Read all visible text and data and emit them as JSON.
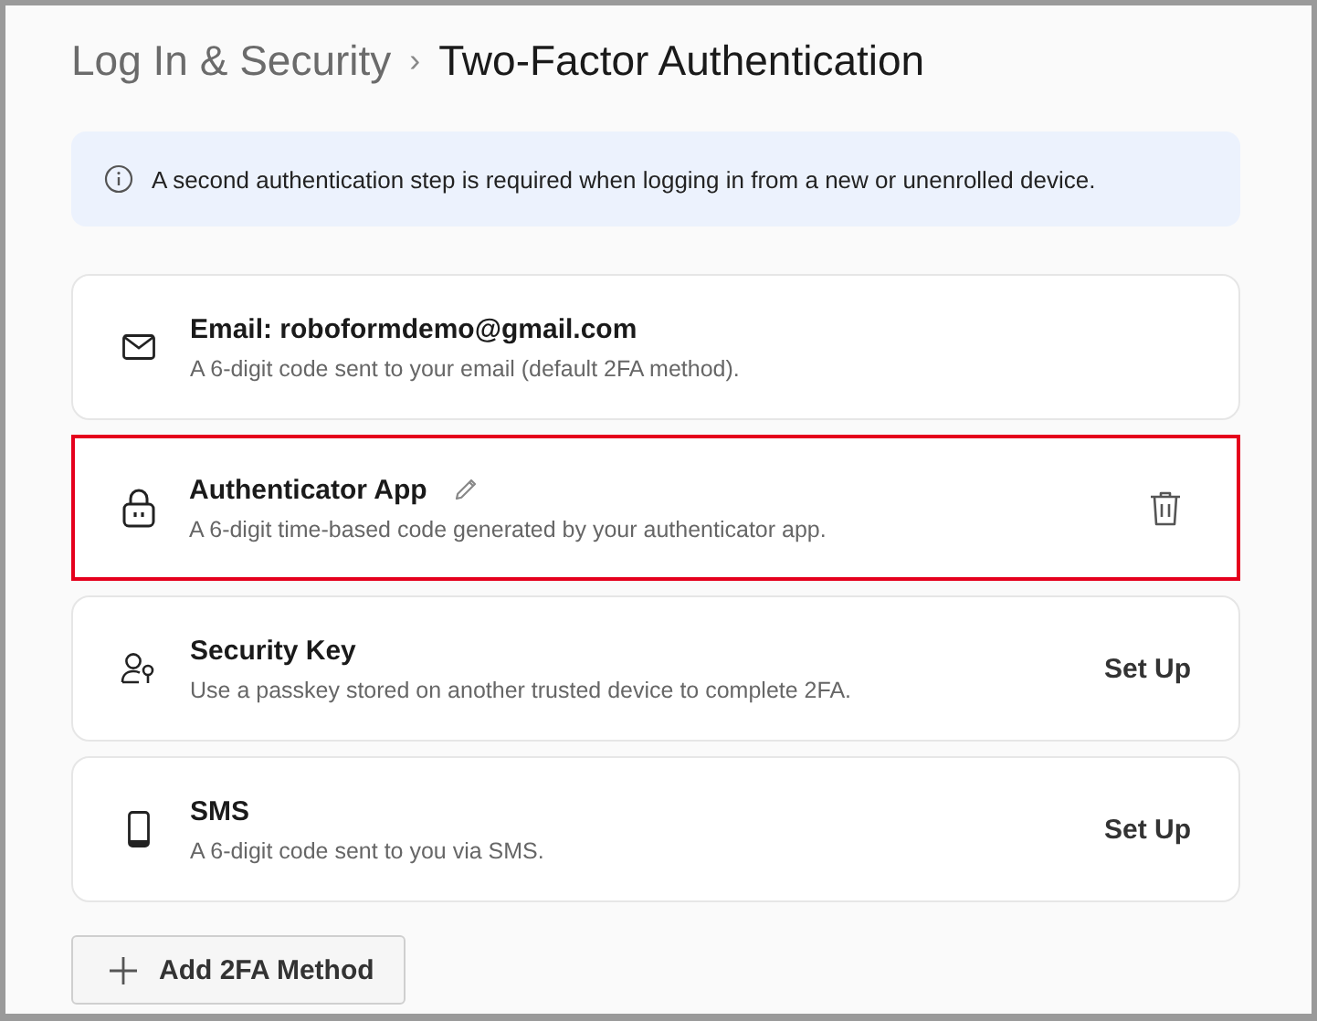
{
  "breadcrumb": {
    "parent": "Log In & Security",
    "separator": "›",
    "current": "Two-Factor Authentication"
  },
  "info": {
    "text": "A second authentication step is required when logging in from a new or unenrolled device."
  },
  "methods": [
    {
      "kind": "email",
      "title": "Email: roboformdemo@gmail.com",
      "description": "A 6-digit code sent to your email (default 2FA method).",
      "editable": false,
      "highlighted": false,
      "action": {
        "kind": "none"
      }
    },
    {
      "kind": "app",
      "title": "Authenticator App",
      "description": "A 6-digit time-based code generated by your authenticator app.",
      "editable": true,
      "highlighted": true,
      "action": {
        "kind": "delete"
      }
    },
    {
      "kind": "key",
      "title": "Security Key",
      "description": "Use a passkey stored on another trusted device to complete 2FA.",
      "editable": false,
      "highlighted": false,
      "action": {
        "kind": "setup",
        "label": "Set Up"
      }
    },
    {
      "kind": "phone",
      "title": "SMS",
      "description": "A 6-digit code sent to you via SMS.",
      "editable": false,
      "highlighted": false,
      "action": {
        "kind": "setup",
        "label": "Set Up"
      }
    }
  ],
  "add_button": {
    "label": "Add 2FA Method"
  }
}
